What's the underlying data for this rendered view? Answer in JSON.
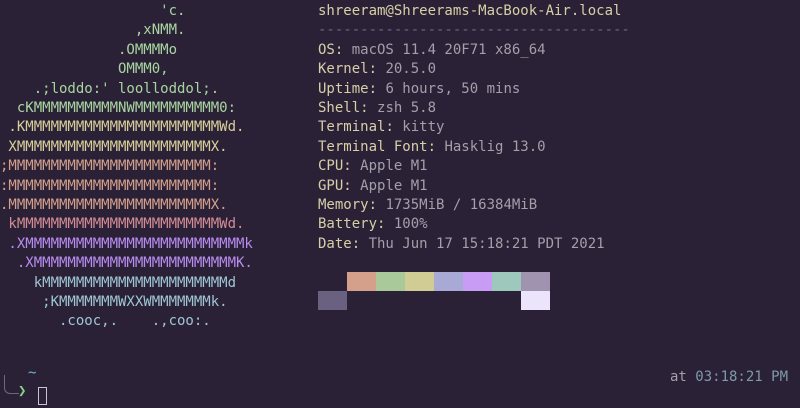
{
  "logo": {
    "lines": [
      {
        "text": "                   'c.",
        "color": "#a9d6a0"
      },
      {
        "text": "                ,xNMM.",
        "color": "#a9d6a0"
      },
      {
        "text": "              .OMMMMo",
        "color": "#a9d6a0"
      },
      {
        "text": "              OMMM0,",
        "color": "#a9d6a0"
      },
      {
        "text": "    .;loddo:' loolloddol;.",
        "color": "#a9d6a0"
      },
      {
        "text": "  cKMMMMMMMMMMNWMMMMMMMMMM0:",
        "color": "#a9d6a0"
      },
      {
        "text": " .KMMMMMMMMMMMMMMMMMMMMMMMWd.",
        "color": "#d8cf9a"
      },
      {
        "text": " XMMMMMMMMMMMMMMMMMMMMMMMX.",
        "color": "#d8cf9a"
      },
      {
        "text": ";MMMMMMMMMMMMMMMMMMMMMMMM:",
        "color": "#d4a08c"
      },
      {
        "text": ":MMMMMMMMMMMMMMMMMMMMMMMM:",
        "color": "#d4a08c"
      },
      {
        "text": ".MMMMMMMMMMMMMMMMMMMMMMMMX.",
        "color": "#d4a08c"
      },
      {
        "text": " kMMMMMMMMMMMMMMMMMMMMMMMMWd.",
        "color": "#d48c96"
      },
      {
        "text": " .XMMMMMMMMMMMMMMMMMMMMMMMMMMk",
        "color": "#b98cf0"
      },
      {
        "text": "  .XMMMMMMMMMMMMMMMMMMMMMMMMK.",
        "color": "#b98cf0"
      },
      {
        "text": "    kMMMMMMMMMMMMMMMMMMMMMMd",
        "color": "#9fc6d4"
      },
      {
        "text": "     ;KMMMMMMMWXXWMMMMMMMk.",
        "color": "#9fc6d4"
      },
      {
        "text": "       .cooc,.    .,coo:.",
        "color": "#9fc6d4"
      }
    ]
  },
  "header": {
    "user_host": "shreeram@Shreerams-MacBook-Air.local",
    "separator": "-------------------------------------"
  },
  "info": [
    {
      "key": "OS",
      "value": "macOS 11.4 20F71 x86_64"
    },
    {
      "key": "Kernel",
      "value": "20.5.0"
    },
    {
      "key": "Uptime",
      "value": "6 hours, 50 mins"
    },
    {
      "key": "Shell",
      "value": "zsh 5.8"
    },
    {
      "key": "Terminal",
      "value": "kitty"
    },
    {
      "key": "Terminal Font",
      "value": "Hasklig 13.0"
    },
    {
      "key": "CPU",
      "value": "Apple M1"
    },
    {
      "key": "GPU",
      "value": "Apple M1"
    },
    {
      "key": "Memory",
      "value": "1735MiB / 16384MiB"
    },
    {
      "key": "Battery",
      "value": "100%"
    },
    {
      "key": "Date",
      "value": "Thu Jun 17 15:18:21 PDT 2021"
    }
  ],
  "key_suffix": ": ",
  "palette": {
    "top": [
      "#2a2137",
      "#d4a08c",
      "#a9c99a",
      "#d1cc94",
      "#a9a9d6",
      "#c89cf4",
      "#9fc8bd",
      "#9f93b0"
    ],
    "bottom": [
      "#6a6180",
      "#2a2137",
      "#2a2137",
      "#2a2137",
      "#2a2137",
      "#2a2137",
      "#2a2137",
      "#ece4fa"
    ]
  },
  "prompt": {
    "cwd": "~",
    "symbol": "❯",
    "status_at": "at",
    "status_time": "03:18:21 PM"
  }
}
